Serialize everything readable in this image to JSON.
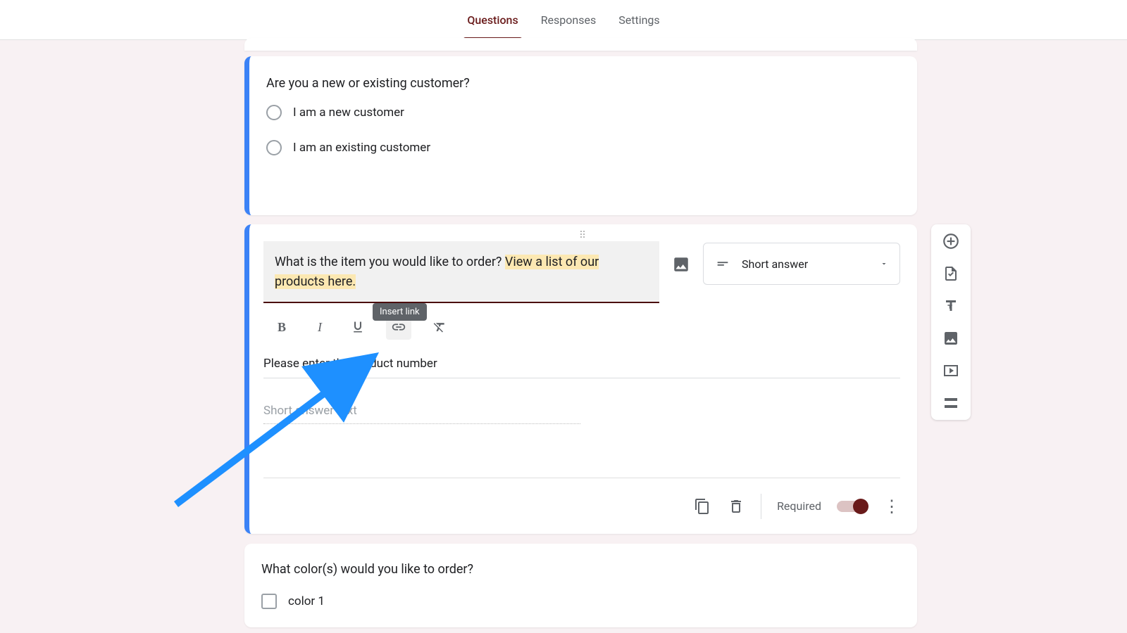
{
  "tabs": {
    "questions": "Questions",
    "responses": "Responses",
    "settings": "Settings"
  },
  "question1": {
    "title": "Are you a new or existing customer?",
    "opt1": "I am a new customer",
    "opt2": "I am an existing customer"
  },
  "question2": {
    "text_part1": "What is the item you would like to order? ",
    "text_highlighted": "View a list of our products here.",
    "tooltip": "Insert link",
    "description": "Please enter the product number",
    "short_placeholder": "Short answer text",
    "type_label": "Short answer",
    "required_label": "Required"
  },
  "question3": {
    "title": "What color(s) would you like to order?",
    "opt1": "color 1"
  },
  "fmt": {
    "bold": "B",
    "italic": "I"
  }
}
